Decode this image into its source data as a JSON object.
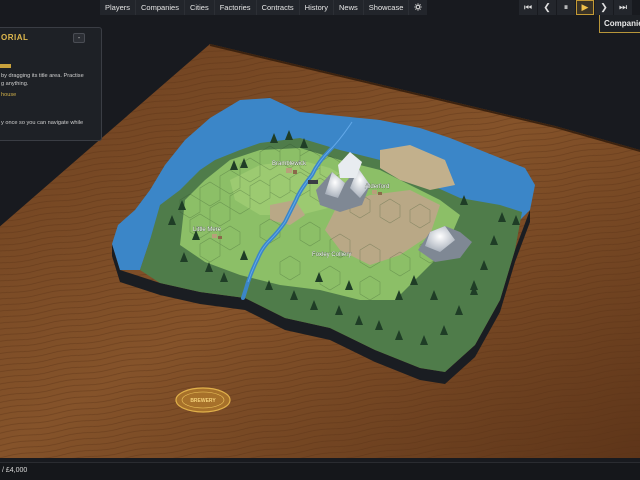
{
  "nav": {
    "items": [
      "Players",
      "Companies",
      "Cities",
      "Factories",
      "Contracts",
      "History",
      "News",
      "Showcase"
    ],
    "settings_icon": "gear-icon"
  },
  "controls": {
    "icons": [
      "skip-back-icon",
      "step-back-icon",
      "pause-icon",
      "play-icon",
      "step-forward-icon",
      "skip-forward-icon"
    ],
    "glyphs": [
      "⏮",
      "❮",
      "⏸",
      "▶",
      "❯",
      "⏭"
    ],
    "active_index": 3
  },
  "companies_panel": {
    "label": "Companies"
  },
  "tutorial": {
    "title": "ORIAL",
    "minimize_glyph": "-",
    "line1": "by dragging its title area. Practise",
    "line2": "g anything.",
    "link": "house",
    "line3": "y once so you can navigate while"
  },
  "map": {
    "towns": [
      {
        "name": "Bramblewick"
      },
      {
        "name": "Alderford"
      },
      {
        "name": "Little Mere"
      },
      {
        "name": "Foxley Colliery"
      }
    ],
    "badge_text": "BREWERY"
  },
  "status": {
    "money": "/ £4,000"
  },
  "colors": {
    "accent": "#c49a35",
    "water": "#3b86c8",
    "grass": "#8cbf67",
    "forest": "#4f7c4a",
    "table": "#7a4a24"
  }
}
